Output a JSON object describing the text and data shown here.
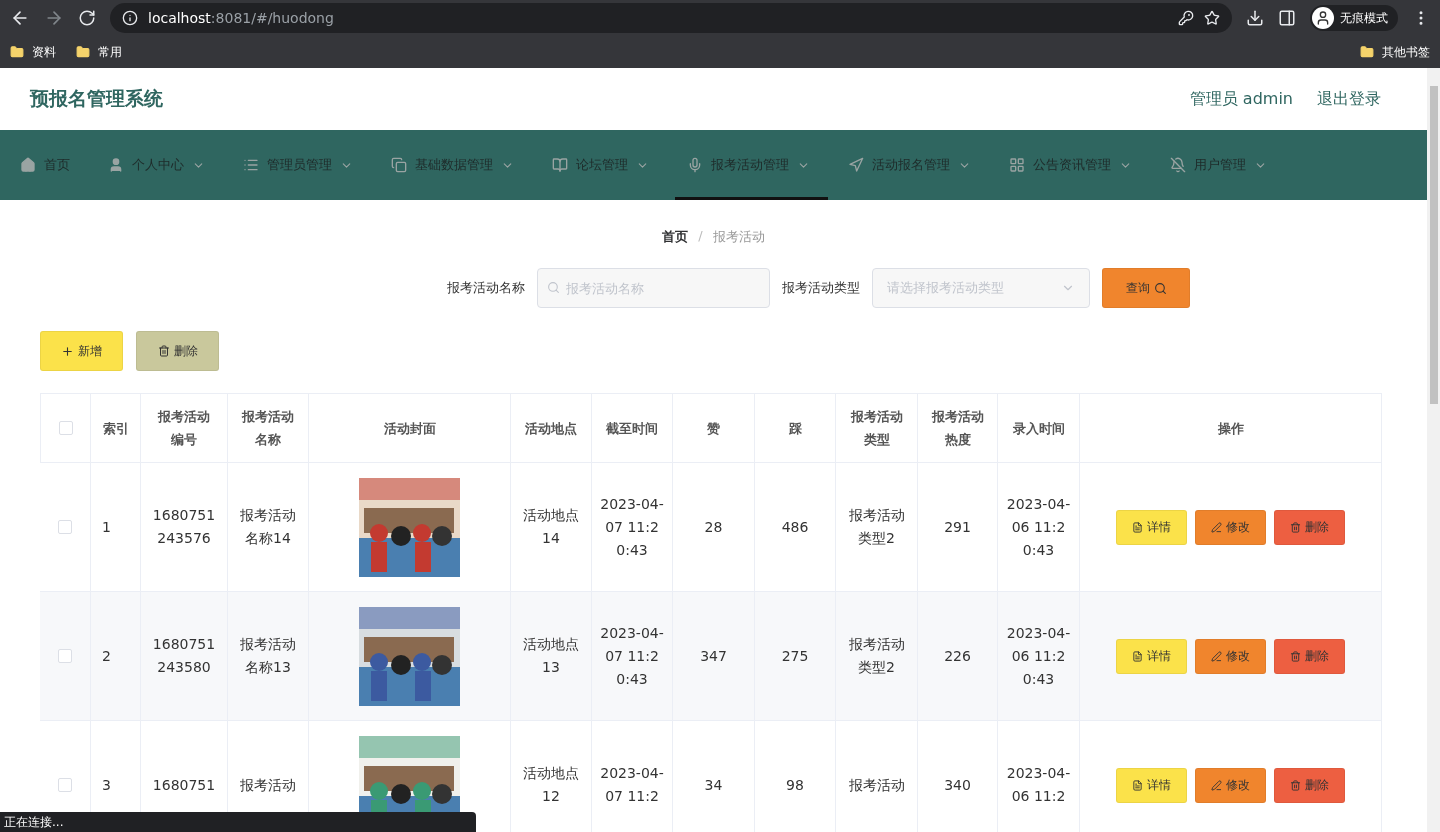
{
  "browser": {
    "url_host": "localhost",
    "url_path": ":8081/#/huodong",
    "profile": "无痕模式",
    "bookmarks": [
      "资料",
      "常用"
    ],
    "other_bookmarks": "其他书签"
  },
  "header": {
    "title": "预报名管理系统",
    "user": "管理员 admin",
    "logout": "退出登录"
  },
  "nav": [
    {
      "label": "首页",
      "dropdown": false,
      "selected": false
    },
    {
      "label": "个人中心",
      "dropdown": true,
      "selected": false
    },
    {
      "label": "管理员管理",
      "dropdown": true,
      "selected": false
    },
    {
      "label": "基础数据管理",
      "dropdown": true,
      "selected": false
    },
    {
      "label": "论坛管理",
      "dropdown": true,
      "selected": false
    },
    {
      "label": "报考活动管理",
      "dropdown": true,
      "selected": true
    },
    {
      "label": "活动报名管理",
      "dropdown": true,
      "selected": false
    },
    {
      "label": "公告资讯管理",
      "dropdown": true,
      "selected": false
    },
    {
      "label": "用户管理",
      "dropdown": true,
      "selected": false
    }
  ],
  "breadcrumb": {
    "home": "首页",
    "separator": "/",
    "current": "报考活动"
  },
  "search": {
    "name_label": "报考活动名称",
    "name_placeholder": "报考活动名称",
    "type_label": "报考活动类型",
    "type_placeholder": "请选择报考活动类型",
    "button": "查询"
  },
  "actions": {
    "add": "新增",
    "delete": "删除"
  },
  "table": {
    "select_all": {
      "checked": false
    },
    "columns": [
      "索引",
      "报考活动编号",
      "报考活动名称",
      "活动封面",
      "活动地点",
      "截至时间",
      "赞",
      "踩",
      "报考活动类型",
      "报考活动热度",
      "录入时间",
      "操作"
    ],
    "rows": [
      {
        "checked": false,
        "index": "1",
        "code": "1680751243576",
        "name": "报考活动名称14",
        "place": "活动地点14",
        "deadline": "2023-04-07 11:20:43",
        "likes": "28",
        "dislikes": "486",
        "type": "报考活动类型2",
        "heat": "291",
        "created": "2023-04-06 11:20:43",
        "buttons": [
          "详情",
          "修改",
          "删除"
        ]
      },
      {
        "checked": false,
        "index": "2",
        "code": "1680751243580",
        "name": "报考活动名称13",
        "place": "活动地点13",
        "deadline": "2023-04-07 11:20:43",
        "likes": "347",
        "dislikes": "275",
        "type": "报考活动类型2",
        "heat": "226",
        "created": "2023-04-06 11:20:43",
        "buttons": [
          "详情",
          "修改",
          "删除"
        ]
      },
      {
        "checked": false,
        "index": "3",
        "code": "1680751",
        "name": "报考活动",
        "place": "活动地点12",
        "deadline": "2023-04-07 11:2",
        "likes": "34",
        "dislikes": "98",
        "type": "报考活动",
        "heat": "340",
        "created": "2023-04-06 11:2",
        "buttons": [
          "详情",
          "修改",
          "删除"
        ]
      }
    ]
  },
  "status": "正在连接..."
}
